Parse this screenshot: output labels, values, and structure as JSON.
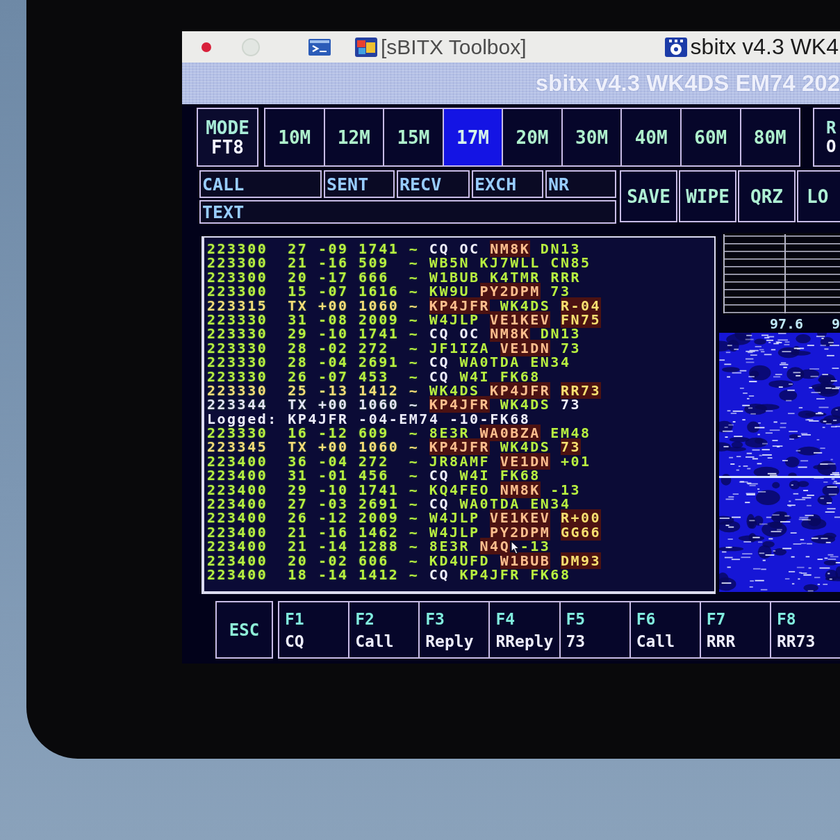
{
  "taskbar": {
    "windows": [
      {
        "label": "[sBITX Toolbox]"
      },
      {
        "label": "sbitx v4.3 WK4"
      }
    ]
  },
  "window": {
    "title": "sbitx v4.3 WK4DS EM74 202"
  },
  "mode": {
    "label": "MODE",
    "value": "FT8"
  },
  "bands": [
    {
      "label": "10M",
      "selected": false
    },
    {
      "label": "12M",
      "selected": false
    },
    {
      "label": "15M",
      "selected": false
    },
    {
      "label": "17M",
      "selected": true
    },
    {
      "label": "20M",
      "selected": false
    },
    {
      "label": "30M",
      "selected": false
    },
    {
      "label": "40M",
      "selected": false
    },
    {
      "label": "60M",
      "selected": false
    },
    {
      "label": "80M",
      "selected": false
    }
  ],
  "edge_button": {
    "lines": [
      "R",
      "O"
    ]
  },
  "entry_fields": [
    {
      "label": "CALL"
    },
    {
      "label": "SENT"
    },
    {
      "label": "RECV"
    },
    {
      "label": "EXCH"
    },
    {
      "label": "NR"
    }
  ],
  "text_field": {
    "label": "TEXT"
  },
  "actions": [
    {
      "label": "SAVE"
    },
    {
      "label": "WIPE"
    },
    {
      "label": "QRZ"
    },
    {
      "label": "LO"
    }
  ],
  "log": {
    "rows": [
      {
        "kind": "decode",
        "color": "#b8f040",
        "time": "223300",
        "snr": "27",
        "dt": "-09",
        "freq": "1741",
        "marker": "~",
        "words": [
          {
            "text": "CQ",
            "kind": "plain"
          },
          {
            "text": "OC",
            "kind": "plain"
          },
          {
            "text": "NM8K",
            "kind": "alert"
          },
          {
            "text": "DN13",
            "kind": "call"
          }
        ]
      },
      {
        "kind": "decode",
        "color": "#b8f040",
        "time": "223300",
        "snr": "21",
        "dt": "-16",
        "freq": "509",
        "marker": "~",
        "words": [
          {
            "text": "WB5N",
            "kind": "call"
          },
          {
            "text": "KJ7WLL",
            "kind": "call"
          },
          {
            "text": "CN85",
            "kind": "call"
          }
        ]
      },
      {
        "kind": "decode",
        "color": "#b8f040",
        "time": "223300",
        "snr": "20",
        "dt": "-17",
        "freq": "666",
        "marker": "~",
        "words": [
          {
            "text": "W1BUB",
            "kind": "call"
          },
          {
            "text": "K4TMR",
            "kind": "call"
          },
          {
            "text": "RRR",
            "kind": "call"
          }
        ]
      },
      {
        "kind": "decode",
        "color": "#b8f040",
        "time": "223300",
        "snr": "15",
        "dt": "-07",
        "freq": "1616",
        "marker": "~",
        "words": [
          {
            "text": "KW9U",
            "kind": "call"
          },
          {
            "text": "PY2DPM",
            "kind": "alert"
          },
          {
            "text": "73",
            "kind": "call"
          }
        ]
      },
      {
        "kind": "decode",
        "color": "#f8dc78",
        "time": "223315",
        "snr": "TX",
        "dt": "+00",
        "freq": "1060",
        "marker": "~",
        "words": [
          {
            "text": "KP4JFR",
            "kind": "alert"
          },
          {
            "text": "WK4DS",
            "kind": "call"
          },
          {
            "text": "R-04",
            "kind": "info"
          }
        ]
      },
      {
        "kind": "decode",
        "color": "#b8f040",
        "time": "223330",
        "snr": "31",
        "dt": "-08",
        "freq": "2009",
        "marker": "~",
        "words": [
          {
            "text": "W4JLP",
            "kind": "call"
          },
          {
            "text": "VE1KEV",
            "kind": "alert"
          },
          {
            "text": "FN75",
            "kind": "info"
          }
        ]
      },
      {
        "kind": "decode",
        "color": "#b8f040",
        "time": "223330",
        "snr": "29",
        "dt": "-10",
        "freq": "1741",
        "marker": "~",
        "words": [
          {
            "text": "CQ",
            "kind": "plain"
          },
          {
            "text": "OC",
            "kind": "plain"
          },
          {
            "text": "NM8K",
            "kind": "alert"
          },
          {
            "text": "DN13",
            "kind": "call"
          }
        ]
      },
      {
        "kind": "decode",
        "color": "#b8f040",
        "time": "223330",
        "snr": "28",
        "dt": "-02",
        "freq": "272",
        "marker": "~",
        "words": [
          {
            "text": "JF1IZA",
            "kind": "call"
          },
          {
            "text": "VE1DN",
            "kind": "alert"
          },
          {
            "text": "73",
            "kind": "call"
          }
        ]
      },
      {
        "kind": "decode",
        "color": "#b8f040",
        "time": "223330",
        "snr": "28",
        "dt": "-04",
        "freq": "2691",
        "marker": "~",
        "words": [
          {
            "text": "CQ",
            "kind": "plain"
          },
          {
            "text": "WA0TDA",
            "kind": "call"
          },
          {
            "text": "EN34",
            "kind": "call"
          }
        ]
      },
      {
        "kind": "decode",
        "color": "#b8f040",
        "time": "223330",
        "snr": "26",
        "dt": "-07",
        "freq": "453",
        "marker": "~",
        "words": [
          {
            "text": "CQ",
            "kind": "plain"
          },
          {
            "text": "W4I",
            "kind": "call"
          },
          {
            "text": "FK68",
            "kind": "call"
          }
        ]
      },
      {
        "kind": "decode",
        "color": "#f8dc78",
        "time": "223330",
        "snr": "25",
        "dt": "-13",
        "freq": "1412",
        "marker": "~",
        "words": [
          {
            "text": "WK4DS",
            "kind": "call"
          },
          {
            "text": "KP4JFR",
            "kind": "alert"
          },
          {
            "text": "RR73",
            "kind": "info"
          }
        ]
      },
      {
        "kind": "decode",
        "color": "#e4e4f8",
        "time": "223344",
        "snr": "TX",
        "dt": "+00",
        "freq": "1060",
        "marker": "~",
        "words": [
          {
            "text": "KP4JFR",
            "kind": "alert"
          },
          {
            "text": "WK4DS",
            "kind": "call"
          },
          {
            "text": "73",
            "kind": "plain"
          }
        ]
      },
      {
        "kind": "logged",
        "text": "Logged: KP4JFR -04-EM74 -10-FK68"
      },
      {
        "kind": "decode",
        "color": "#b8f040",
        "time": "223330",
        "snr": "16",
        "dt": "-12",
        "freq": "609",
        "marker": "~",
        "words": [
          {
            "text": "8E3R",
            "kind": "call"
          },
          {
            "text": "WA0BZA",
            "kind": "alert"
          },
          {
            "text": "EM48",
            "kind": "call"
          }
        ]
      },
      {
        "kind": "decode",
        "color": "#f8dc78",
        "time": "223345",
        "snr": "TX",
        "dt": "+00",
        "freq": "1060",
        "marker": "~",
        "words": [
          {
            "text": "KP4JFR",
            "kind": "alert"
          },
          {
            "text": "WK4DS",
            "kind": "call"
          },
          {
            "text": "73",
            "kind": "info"
          }
        ]
      },
      {
        "kind": "decode",
        "color": "#b8f040",
        "time": "223400",
        "snr": "36",
        "dt": "-04",
        "freq": "272",
        "marker": "~",
        "words": [
          {
            "text": "JR8AMF",
            "kind": "call"
          },
          {
            "text": "VE1DN",
            "kind": "alert"
          },
          {
            "text": "+01",
            "kind": "call"
          }
        ]
      },
      {
        "kind": "decode",
        "color": "#b8f040",
        "time": "223400",
        "snr": "31",
        "dt": "-01",
        "freq": "456",
        "marker": "~",
        "words": [
          {
            "text": "CQ",
            "kind": "plain"
          },
          {
            "text": "W4I",
            "kind": "call"
          },
          {
            "text": "FK68",
            "kind": "call"
          }
        ]
      },
      {
        "kind": "decode",
        "color": "#b8f040",
        "time": "223400",
        "snr": "29",
        "dt": "-10",
        "freq": "1741",
        "marker": "~",
        "words": [
          {
            "text": "KQ4FEO",
            "kind": "call"
          },
          {
            "text": "NM8K",
            "kind": "alert"
          },
          {
            "text": "-13",
            "kind": "call"
          }
        ]
      },
      {
        "kind": "decode",
        "color": "#b8f040",
        "time": "223400",
        "snr": "27",
        "dt": "-03",
        "freq": "2691",
        "marker": "~",
        "words": [
          {
            "text": "CQ",
            "kind": "plain"
          },
          {
            "text": "WA0TDA",
            "kind": "call"
          },
          {
            "text": "EN34",
            "kind": "call"
          }
        ]
      },
      {
        "kind": "decode",
        "color": "#b8f040",
        "time": "223400",
        "snr": "26",
        "dt": "-12",
        "freq": "2009",
        "marker": "~",
        "words": [
          {
            "text": "W4JLP",
            "kind": "call"
          },
          {
            "text": "VE1KEV",
            "kind": "alert"
          },
          {
            "text": "R+00",
            "kind": "info"
          }
        ]
      },
      {
        "kind": "decode",
        "color": "#b8f040",
        "time": "223400",
        "snr": "21",
        "dt": "-16",
        "freq": "1462",
        "marker": "~",
        "words": [
          {
            "text": "W4JLP",
            "kind": "call"
          },
          {
            "text": "PY2DPM",
            "kind": "alert"
          },
          {
            "text": "GG66",
            "kind": "info"
          }
        ]
      },
      {
        "kind": "decode",
        "color": "#b8f040",
        "time": "223400",
        "snr": "21",
        "dt": "-14",
        "freq": "1288",
        "marker": "~",
        "words": [
          {
            "text": "8E3R",
            "kind": "call"
          },
          {
            "text": "N4Q",
            "kind": "alert"
          },
          {
            "text": "-13",
            "kind": "call"
          }
        ]
      },
      {
        "kind": "decode",
        "color": "#b8f040",
        "time": "223400",
        "snr": "20",
        "dt": "-02",
        "freq": "606",
        "marker": "~",
        "words": [
          {
            "text": "KD4UFD",
            "kind": "call"
          },
          {
            "text": "W1BUB",
            "kind": "alert"
          },
          {
            "text": "DM93",
            "kind": "info"
          }
        ]
      },
      {
        "kind": "decode",
        "color": "#b8f040",
        "time": "223400",
        "snr": "18",
        "dt": "-14",
        "freq": "1412",
        "marker": "~",
        "words": [
          {
            "text": "CQ",
            "kind": "plain"
          },
          {
            "text": "KP4JFR",
            "kind": "call"
          },
          {
            "text": "FK68",
            "kind": "call"
          }
        ]
      }
    ]
  },
  "waterfall": {
    "scale_labels": [
      "97.6",
      "9"
    ]
  },
  "escape_key": {
    "label": "ESC"
  },
  "function_keys": [
    {
      "key": "F1",
      "label": "CQ"
    },
    {
      "key": "F2",
      "label": "Call"
    },
    {
      "key": "F3",
      "label": "Reply"
    },
    {
      "key": "F4",
      "label": "RReply"
    },
    {
      "key": "F5",
      "label": "73"
    },
    {
      "key": "F6",
      "label": "Call"
    },
    {
      "key": "F7",
      "label": "RRR"
    },
    {
      "key": "F8",
      "label": "RR73"
    }
  ]
}
